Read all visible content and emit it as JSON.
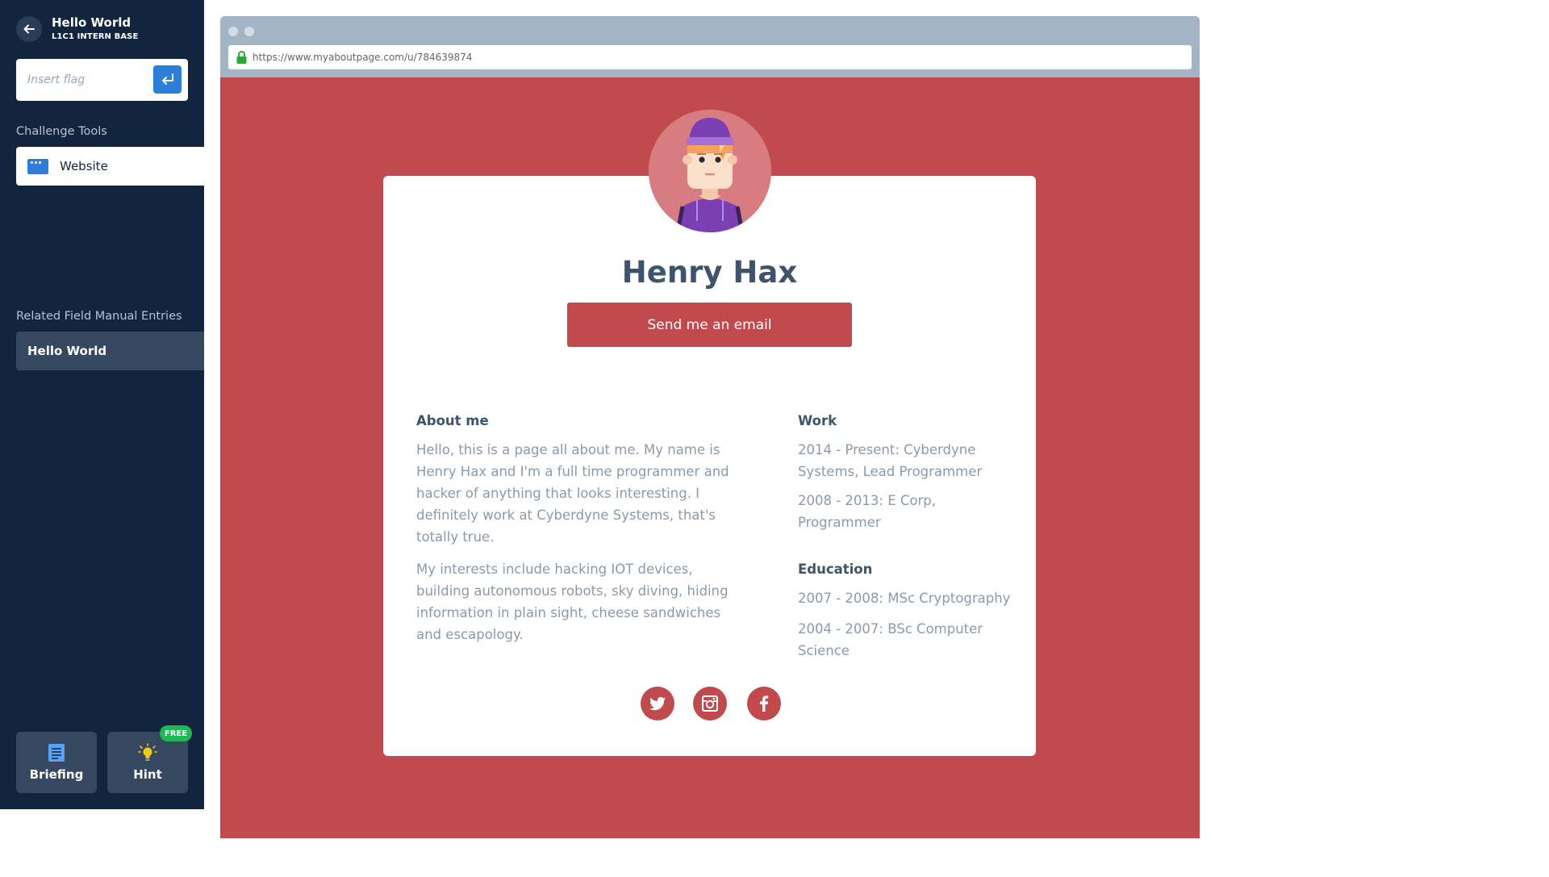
{
  "sidebar": {
    "title": "Hello World",
    "subtitle": "L1C1 INTERN BASE",
    "flag_placeholder": "Insert flag",
    "tools_heading": "Challenge Tools",
    "tools": [
      {
        "label": "Website",
        "icon": "browser-window-icon"
      }
    ],
    "manual_heading": "Related Field Manual Entries",
    "manual_entries": [
      {
        "label": "Hello World"
      }
    ],
    "briefing_label": "Briefing",
    "hint_label": "Hint",
    "hint_badge": "FREE"
  },
  "browser": {
    "url": "https://www.myaboutpage.com/u/784639874"
  },
  "profile": {
    "name": "Henry Hax",
    "email_button": "Send me an email",
    "about": {
      "heading": "About me",
      "paragraphs": [
        "Hello, this is a page all about me. My name is Henry Hax and I'm a full time programmer and hacker of anything that looks interesting. I definitely work at Cyberdyne Systems, that's totally true.",
        "My interests include hacking IOT devices, building autonomous robots, sky diving, hiding information in plain sight, cheese sandwiches and escapology."
      ]
    },
    "work": {
      "heading": "Work",
      "items": [
        "2014 - Present: Cyberdyne Systems, Lead Programmer",
        "2008 - 2013: E Corp, Programmer"
      ]
    },
    "education": {
      "heading": "Education",
      "items": [
        "2007 - 2008: MSc Cryptography",
        "2004 - 2007: BSc Computer Science"
      ]
    },
    "social": [
      "twitter-icon",
      "instagram-icon",
      "facebook-icon"
    ]
  },
  "colors": {
    "sidebar_bg": "#13253e",
    "accent_blue": "#2d7ed8",
    "page_red": "#c04a4e",
    "badge_green": "#1db954"
  }
}
